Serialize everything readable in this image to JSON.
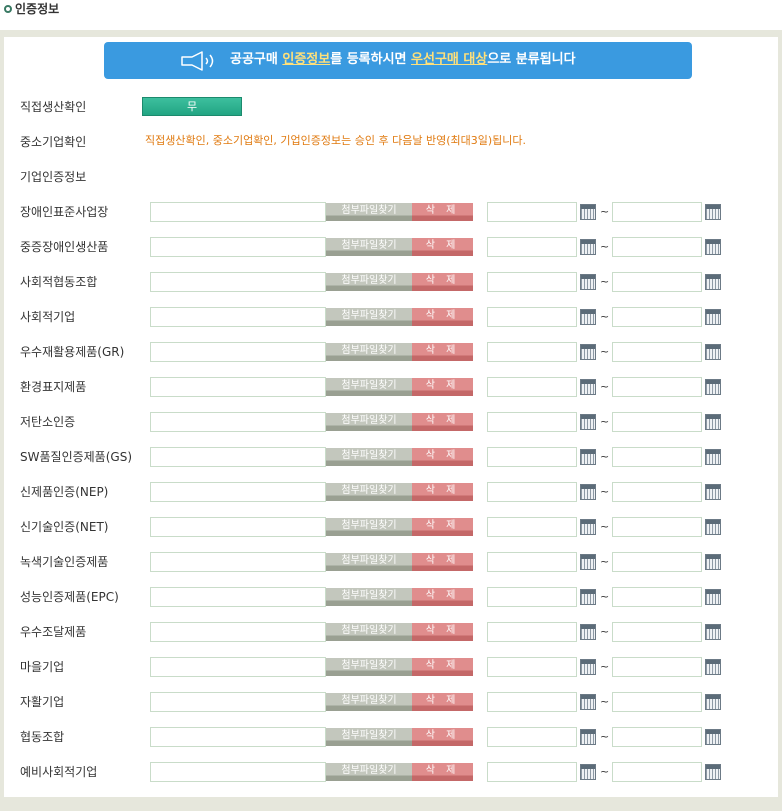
{
  "section_title": "인증정보",
  "notice": {
    "part1": "공공구매 ",
    "hl1": "인증정보",
    "part2": "를 등록하시면 ",
    "hl2": "우선구매 대상",
    "part3": "으로 분류됩니다"
  },
  "direct_production": {
    "label": "직접생산확인",
    "value": "무"
  },
  "sme": {
    "label": "중소기업확인",
    "message": "직접생산확인, 중소기업확인, 기업인증정보는 승인 후 다음날 반영(최대3일)됩니다."
  },
  "company_cert": {
    "label": "기업인증정보"
  },
  "buttons": {
    "attach": "첨부파일찾기",
    "delete": "삭 제"
  },
  "range_separator": "~",
  "certifications": [
    "장애인표준사업장",
    "중증장애인생산품",
    "사회적협동조합",
    "사회적기업",
    "우수재활용제품(GR)",
    "환경표지제품",
    "저탄소인증",
    "SW품질인증제품(GS)",
    "신제품인증(NEP)",
    "신기술인증(NET)",
    "녹색기술인증제품",
    "성능인증제품(EPC)",
    "우수조달제품",
    "마을기업",
    "자활기업",
    "협동조합",
    "예비사회적기업"
  ]
}
